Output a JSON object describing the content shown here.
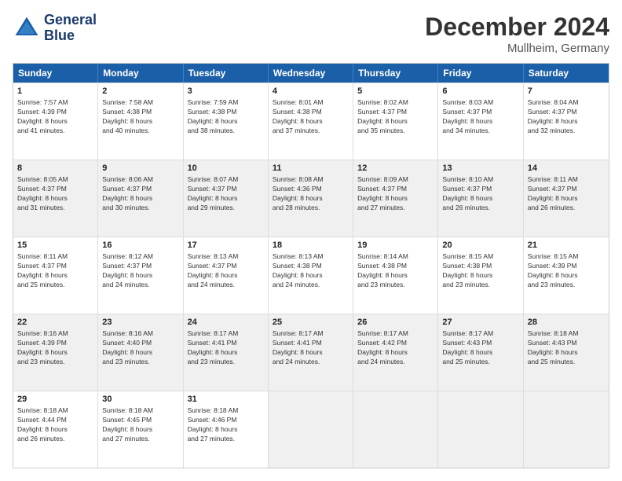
{
  "header": {
    "month": "December 2024",
    "location": "Mullheim, Germany",
    "logo_line1": "General",
    "logo_line2": "Blue"
  },
  "days_of_week": [
    "Sunday",
    "Monday",
    "Tuesday",
    "Wednesday",
    "Thursday",
    "Friday",
    "Saturday"
  ],
  "rows": [
    [
      {
        "day": "1",
        "lines": [
          "Sunrise: 7:57 AM",
          "Sunset: 4:39 PM",
          "Daylight: 8 hours",
          "and 41 minutes."
        ],
        "shaded": false
      },
      {
        "day": "2",
        "lines": [
          "Sunrise: 7:58 AM",
          "Sunset: 4:38 PM",
          "Daylight: 8 hours",
          "and 40 minutes."
        ],
        "shaded": false
      },
      {
        "day": "3",
        "lines": [
          "Sunrise: 7:59 AM",
          "Sunset: 4:38 PM",
          "Daylight: 8 hours",
          "and 38 minutes."
        ],
        "shaded": false
      },
      {
        "day": "4",
        "lines": [
          "Sunrise: 8:01 AM",
          "Sunset: 4:38 PM",
          "Daylight: 8 hours",
          "and 37 minutes."
        ],
        "shaded": false
      },
      {
        "day": "5",
        "lines": [
          "Sunrise: 8:02 AM",
          "Sunset: 4:37 PM",
          "Daylight: 8 hours",
          "and 35 minutes."
        ],
        "shaded": false
      },
      {
        "day": "6",
        "lines": [
          "Sunrise: 8:03 AM",
          "Sunset: 4:37 PM",
          "Daylight: 8 hours",
          "and 34 minutes."
        ],
        "shaded": false
      },
      {
        "day": "7",
        "lines": [
          "Sunrise: 8:04 AM",
          "Sunset: 4:37 PM",
          "Daylight: 8 hours",
          "and 32 minutes."
        ],
        "shaded": false
      }
    ],
    [
      {
        "day": "8",
        "lines": [
          "Sunrise: 8:05 AM",
          "Sunset: 4:37 PM",
          "Daylight: 8 hours",
          "and 31 minutes."
        ],
        "shaded": true
      },
      {
        "day": "9",
        "lines": [
          "Sunrise: 8:06 AM",
          "Sunset: 4:37 PM",
          "Daylight: 8 hours",
          "and 30 minutes."
        ],
        "shaded": true
      },
      {
        "day": "10",
        "lines": [
          "Sunrise: 8:07 AM",
          "Sunset: 4:37 PM",
          "Daylight: 8 hours",
          "and 29 minutes."
        ],
        "shaded": true
      },
      {
        "day": "11",
        "lines": [
          "Sunrise: 8:08 AM",
          "Sunset: 4:36 PM",
          "Daylight: 8 hours",
          "and 28 minutes."
        ],
        "shaded": true
      },
      {
        "day": "12",
        "lines": [
          "Sunrise: 8:09 AM",
          "Sunset: 4:37 PM",
          "Daylight: 8 hours",
          "and 27 minutes."
        ],
        "shaded": true
      },
      {
        "day": "13",
        "lines": [
          "Sunrise: 8:10 AM",
          "Sunset: 4:37 PM",
          "Daylight: 8 hours",
          "and 26 minutes."
        ],
        "shaded": true
      },
      {
        "day": "14",
        "lines": [
          "Sunrise: 8:11 AM",
          "Sunset: 4:37 PM",
          "Daylight: 8 hours",
          "and 26 minutes."
        ],
        "shaded": true
      }
    ],
    [
      {
        "day": "15",
        "lines": [
          "Sunrise: 8:11 AM",
          "Sunset: 4:37 PM",
          "Daylight: 8 hours",
          "and 25 minutes."
        ],
        "shaded": false
      },
      {
        "day": "16",
        "lines": [
          "Sunrise: 8:12 AM",
          "Sunset: 4:37 PM",
          "Daylight: 8 hours",
          "and 24 minutes."
        ],
        "shaded": false
      },
      {
        "day": "17",
        "lines": [
          "Sunrise: 8:13 AM",
          "Sunset: 4:37 PM",
          "Daylight: 8 hours",
          "and 24 minutes."
        ],
        "shaded": false
      },
      {
        "day": "18",
        "lines": [
          "Sunrise: 8:13 AM",
          "Sunset: 4:38 PM",
          "Daylight: 8 hours",
          "and 24 minutes."
        ],
        "shaded": false
      },
      {
        "day": "19",
        "lines": [
          "Sunrise: 8:14 AM",
          "Sunset: 4:38 PM",
          "Daylight: 8 hours",
          "and 23 minutes."
        ],
        "shaded": false
      },
      {
        "day": "20",
        "lines": [
          "Sunrise: 8:15 AM",
          "Sunset: 4:38 PM",
          "Daylight: 8 hours",
          "and 23 minutes."
        ],
        "shaded": false
      },
      {
        "day": "21",
        "lines": [
          "Sunrise: 8:15 AM",
          "Sunset: 4:39 PM",
          "Daylight: 8 hours",
          "and 23 minutes."
        ],
        "shaded": false
      }
    ],
    [
      {
        "day": "22",
        "lines": [
          "Sunrise: 8:16 AM",
          "Sunset: 4:39 PM",
          "Daylight: 8 hours",
          "and 23 minutes."
        ],
        "shaded": true
      },
      {
        "day": "23",
        "lines": [
          "Sunrise: 8:16 AM",
          "Sunset: 4:40 PM",
          "Daylight: 8 hours",
          "and 23 minutes."
        ],
        "shaded": true
      },
      {
        "day": "24",
        "lines": [
          "Sunrise: 8:17 AM",
          "Sunset: 4:41 PM",
          "Daylight: 8 hours",
          "and 23 minutes."
        ],
        "shaded": true
      },
      {
        "day": "25",
        "lines": [
          "Sunrise: 8:17 AM",
          "Sunset: 4:41 PM",
          "Daylight: 8 hours",
          "and 24 minutes."
        ],
        "shaded": true
      },
      {
        "day": "26",
        "lines": [
          "Sunrise: 8:17 AM",
          "Sunset: 4:42 PM",
          "Daylight: 8 hours",
          "and 24 minutes."
        ],
        "shaded": true
      },
      {
        "day": "27",
        "lines": [
          "Sunrise: 8:17 AM",
          "Sunset: 4:43 PM",
          "Daylight: 8 hours",
          "and 25 minutes."
        ],
        "shaded": true
      },
      {
        "day": "28",
        "lines": [
          "Sunrise: 8:18 AM",
          "Sunset: 4:43 PM",
          "Daylight: 8 hours",
          "and 25 minutes."
        ],
        "shaded": true
      }
    ],
    [
      {
        "day": "29",
        "lines": [
          "Sunrise: 8:18 AM",
          "Sunset: 4:44 PM",
          "Daylight: 8 hours",
          "and 26 minutes."
        ],
        "shaded": false
      },
      {
        "day": "30",
        "lines": [
          "Sunrise: 8:18 AM",
          "Sunset: 4:45 PM",
          "Daylight: 8 hours",
          "and 27 minutes."
        ],
        "shaded": false
      },
      {
        "day": "31",
        "lines": [
          "Sunrise: 8:18 AM",
          "Sunset: 4:46 PM",
          "Daylight: 8 hours",
          "and 27 minutes."
        ],
        "shaded": false
      },
      {
        "day": "",
        "lines": [],
        "shaded": true,
        "empty": true
      },
      {
        "day": "",
        "lines": [],
        "shaded": true,
        "empty": true
      },
      {
        "day": "",
        "lines": [],
        "shaded": true,
        "empty": true
      },
      {
        "day": "",
        "lines": [],
        "shaded": true,
        "empty": true
      }
    ]
  ]
}
